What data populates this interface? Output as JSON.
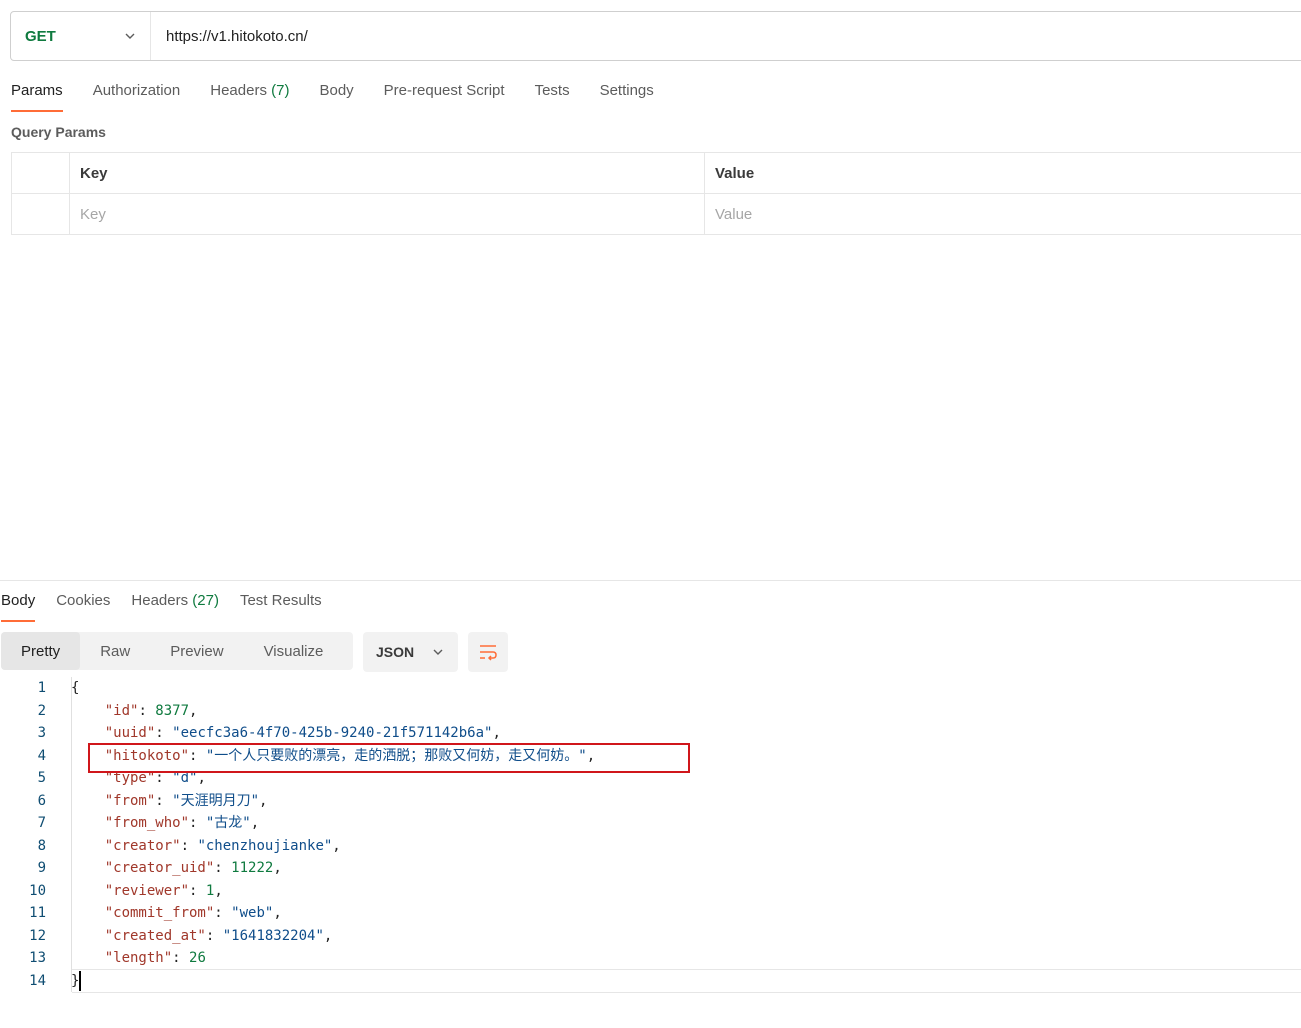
{
  "request": {
    "method": "GET",
    "url": "https://v1.hitokoto.cn/"
  },
  "request_tabs": [
    {
      "label": "Params",
      "count": ""
    },
    {
      "label": "Authorization",
      "count": ""
    },
    {
      "label": "Headers ",
      "count": "(7)"
    },
    {
      "label": "Body",
      "count": ""
    },
    {
      "label": "Pre-request Script",
      "count": ""
    },
    {
      "label": "Tests",
      "count": ""
    },
    {
      "label": "Settings",
      "count": ""
    }
  ],
  "query_params": {
    "title": "Query Params",
    "key_header": "Key",
    "value_header": "Value",
    "key_placeholder": "Key",
    "value_placeholder": "Value"
  },
  "response_tabs": [
    {
      "label": "Body",
      "count": ""
    },
    {
      "label": "Cookies",
      "count": ""
    },
    {
      "label": "Headers ",
      "count": "(27)"
    },
    {
      "label": "Test Results",
      "count": ""
    }
  ],
  "view_modes": [
    "Pretty",
    "Raw",
    "Preview",
    "Visualize"
  ],
  "format": "JSON",
  "code_lines": [
    "{",
    "    \"id\": 8377,",
    "    \"uuid\": \"eecfc3a6-4f70-425b-9240-21f571142b6a\",",
    "    \"hitokoto\": \"一个人只要败的漂亮，走的洒脱；那败又何妨，走又何妨。\",",
    "    \"type\": \"d\",",
    "    \"from\": \"天涯明月刀\",",
    "    \"from_who\": \"古龙\",",
    "    \"creator\": \"chenzhoujianke\",",
    "    \"creator_uid\": 11222,",
    "    \"reviewer\": 1,",
    "    \"commit_from\": \"web\",",
    "    \"created_at\": \"1641832204\",",
    "    \"length\": 26",
    "}"
  ],
  "colors": {
    "accent": "#ff6c37",
    "method_green": "#0f7a3f",
    "highlight_red": "#d0161b"
  }
}
